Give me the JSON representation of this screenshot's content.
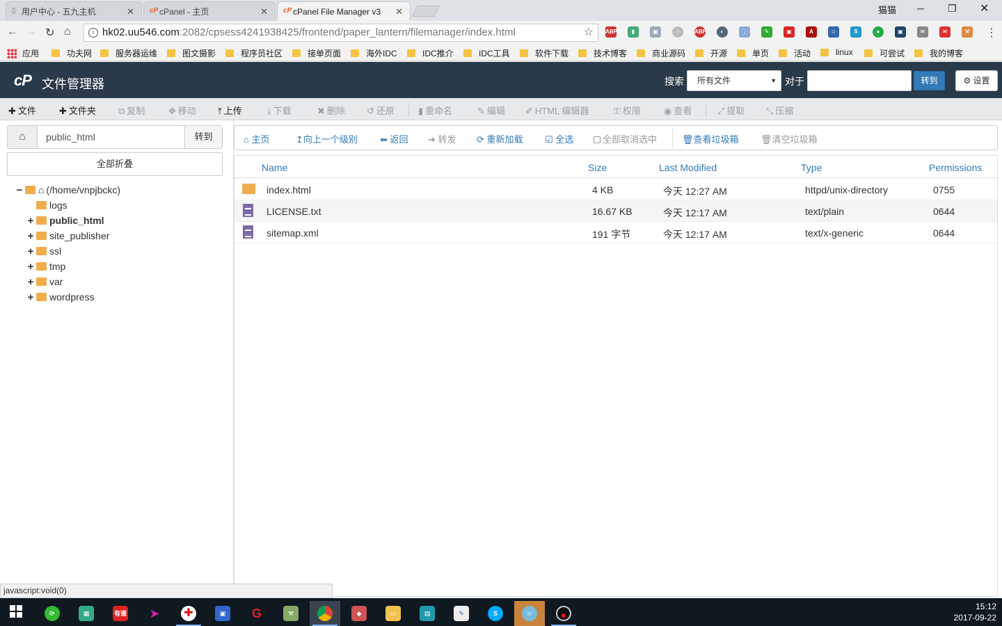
{
  "browser": {
    "tabs": [
      {
        "title": "用户中心 - 五九主机",
        "active": false
      },
      {
        "title": "cPanel - 主页",
        "active": false
      },
      {
        "title": "cPanel File Manager v3",
        "active": true
      }
    ],
    "window_user_label": "猫猫",
    "url_host": "hk02.uu546.com",
    "url_path": ":2082/cpsess4241938425/frontend/paper_lantern/filemanager/index.html",
    "bookmarks": [
      "应用",
      "功夫网",
      "服务器运维",
      "图文摄影",
      "程序员社区",
      "接单页面",
      "海外IDC",
      "IDC推介",
      "IDC工具",
      "软件下载",
      "技术博客",
      "商业源码",
      "开源",
      "单页",
      "活动",
      "linux",
      "可尝试",
      "我的博客"
    ]
  },
  "cpanel": {
    "logo": "cP",
    "title": "文件管理器",
    "search_label": "搜索",
    "search_scope": "所有文件",
    "for_label": "对于",
    "go_label": "转到",
    "settings_label": "设置"
  },
  "toolbar": [
    {
      "label": "文件",
      "icon": "plus",
      "enabled": true
    },
    {
      "label": "文件夹",
      "icon": "plus",
      "enabled": true
    },
    {
      "label": "复制",
      "icon": "copy",
      "enabled": false
    },
    {
      "label": "移动",
      "icon": "move",
      "enabled": false
    },
    {
      "label": "上传",
      "icon": "upload",
      "enabled": true
    },
    {
      "label": "下载",
      "icon": "download",
      "enabled": false
    },
    {
      "label": "删除",
      "icon": "times",
      "enabled": false
    },
    {
      "label": "还原",
      "icon": "undo",
      "enabled": false
    },
    {
      "label": "重命名",
      "icon": "file",
      "enabled": false
    },
    {
      "label": "编辑",
      "icon": "pencil",
      "enabled": false
    },
    {
      "label": "HTML 编辑器",
      "icon": "edit",
      "enabled": false
    },
    {
      "label": "权限",
      "icon": "key",
      "enabled": false
    },
    {
      "label": "查看",
      "icon": "eye",
      "enabled": false
    },
    {
      "label": "提取",
      "icon": "expand",
      "enabled": false
    },
    {
      "label": "压缩",
      "icon": "compress",
      "enabled": false
    }
  ],
  "path": {
    "value": "public_html",
    "go_label": "转到"
  },
  "collapse_all_label": "全部折叠",
  "tree": [
    {
      "label": "(/home/vnpjbckc)",
      "toggle": "−",
      "root": true
    },
    {
      "label": "logs",
      "toggle": ""
    },
    {
      "label": "public_html",
      "toggle": "+",
      "current": true
    },
    {
      "label": "site_publisher",
      "toggle": "+"
    },
    {
      "label": "ssl",
      "toggle": "+"
    },
    {
      "label": "tmp",
      "toggle": "+"
    },
    {
      "label": "var",
      "toggle": "+"
    },
    {
      "label": "wordpress",
      "toggle": "+"
    }
  ],
  "navbar": [
    {
      "label": "主页",
      "icon": "home",
      "enabled": true
    },
    {
      "label": "向上一个级别",
      "icon": "level-up",
      "enabled": true
    },
    {
      "label": "返回",
      "icon": "arrow-left",
      "enabled": true
    },
    {
      "label": "转发",
      "icon": "arrow-right",
      "enabled": false
    },
    {
      "label": "重新加载",
      "icon": "refresh",
      "enabled": true
    },
    {
      "label": "全选",
      "icon": "check-square",
      "enabled": true
    },
    {
      "label": "全部取消选中",
      "icon": "square",
      "enabled": false
    },
    {
      "label": "查看垃圾箱",
      "icon": "trash",
      "enabled": true
    },
    {
      "label": "清空垃圾箱",
      "icon": "trash",
      "enabled": false
    }
  ],
  "file_table": {
    "columns": [
      "Name",
      "Size",
      "Last Modified",
      "Type",
      "Permissions"
    ],
    "rows": [
      {
        "name": "index.html",
        "size": "4 KB",
        "modified": "今天 12:27 AM",
        "type": "httpd/unix-directory",
        "perms": "0755",
        "kind": "folder"
      },
      {
        "name": "LICENSE.txt",
        "size": "16.67 KB",
        "modified": "今天 12:17 AM",
        "type": "text/plain",
        "perms": "0644",
        "kind": "file"
      },
      {
        "name": "sitemap.xml",
        "size": "191 字节",
        "modified": "今天 12:17 AM",
        "type": "text/x-generic",
        "perms": "0644",
        "kind": "file"
      }
    ]
  },
  "status_text": "javascript:void(0)",
  "clock": {
    "time": "15:12",
    "date": "2017-09-22"
  },
  "colors": {
    "header_bg": "#293a4a",
    "link_blue": "#337ab7",
    "folder": "#f0ad4e",
    "doc": "#7d6aa8"
  }
}
